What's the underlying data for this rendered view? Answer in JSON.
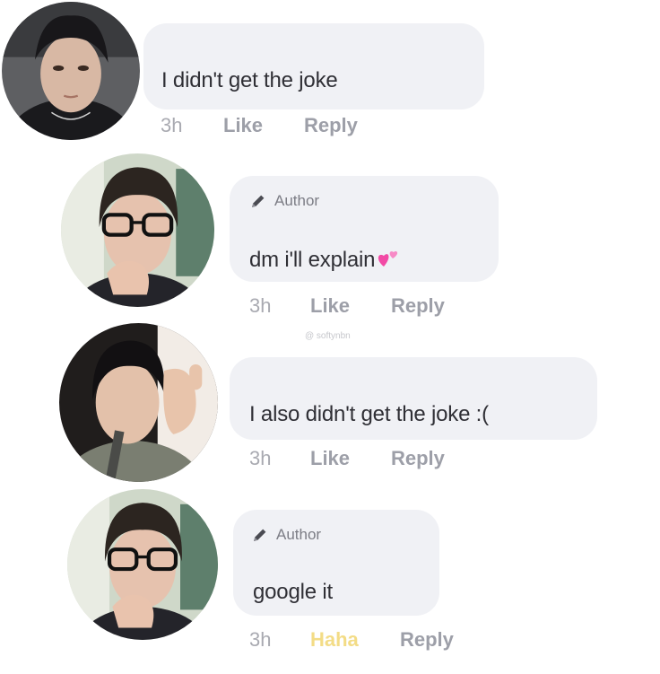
{
  "watermark": "@ softynbn",
  "comments": [
    {
      "author_badge": "",
      "text": "I didn't get the joke",
      "time": "3h",
      "reaction": "Like",
      "reply": "Reply"
    },
    {
      "author_badge": "Author",
      "text": "dm i'll explain",
      "emoji": "two-hearts-emoji",
      "time": "3h",
      "reaction": "Like",
      "reply": "Reply"
    },
    {
      "author_badge": "",
      "text": "I also didn't get the joke :(",
      "time": "3h",
      "reaction": "Like",
      "reply": "Reply"
    },
    {
      "author_badge": "Author",
      "text": "google it",
      "time": "3h",
      "reaction": "Haha",
      "reply": "Reply"
    }
  ],
  "colors": {
    "bubble": "#f0f1f5",
    "text": "#2f2f35",
    "action": "#9d9fa8",
    "haha": "#f3dc86"
  }
}
